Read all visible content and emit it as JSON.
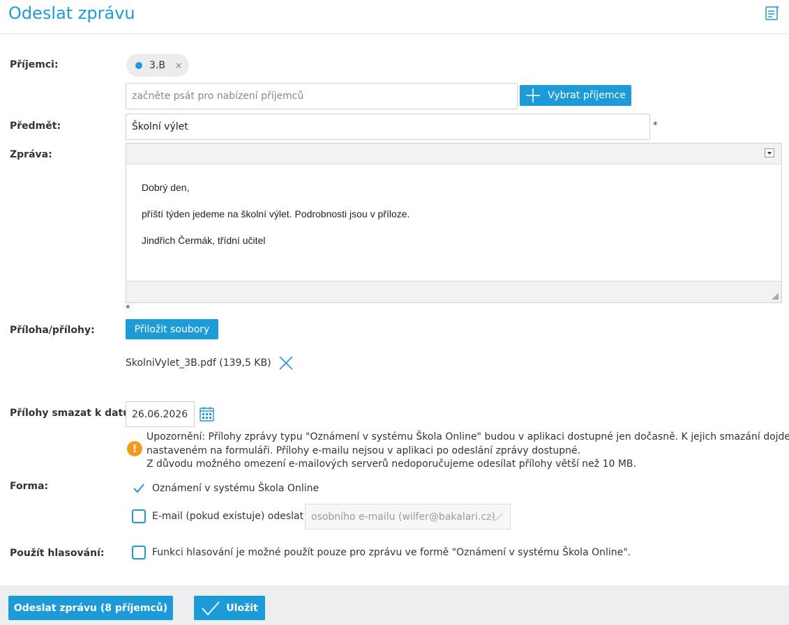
{
  "header": {
    "title": "Odeslat zprávu",
    "help_icon": "help-notes-icon"
  },
  "recipients": {
    "label": "Příjemci:",
    "chips": [
      {
        "text": "3.B",
        "remove": "×"
      }
    ],
    "input_placeholder": "začněte psát pro nabízení příjemců",
    "select_button": "Vybrat příjemce"
  },
  "subject": {
    "label": "Předmět:",
    "value": "Školní výlet",
    "required_mark": "*"
  },
  "message": {
    "label": "Zpráva:",
    "lines": [
      "Dobrý den,",
      "příští týden jedeme na školní výlet. Podrobnosti jsou v příloze.",
      "Jindřich Čermák, třídní učitel"
    ],
    "required_mark": "*"
  },
  "attachments": {
    "label": "Příloha/přílohy:",
    "attach_button": "Přiložit soubory",
    "files": [
      {
        "name": "SkolniVylet_3B.pdf (139,5 KB)"
      }
    ]
  },
  "delete_date": {
    "label": "Přílohy smazat k datu:",
    "value": "26.06.2026",
    "warning_lines": [
      "Upozornění: Přílohy zprávy typu \"Oznámení v systému Škola Online\" budou v aplikaci dostupné jen dočasně. K jejich smazání dojde k datu",
      "nastaveném na formuláři. Přílohy e-mailu nejsou v aplikaci po odeslání zprávy dostupné.",
      "Z důvodu možného omezení e-mailových serverů nedoporučujeme odesílat přílohy větší než 10 MB."
    ],
    "warning_icon": "!"
  },
  "form": {
    "label": "Forma:",
    "option_notice": {
      "label": "Oznámení v systému Škola Online",
      "checked": true
    },
    "option_email": {
      "label": "E-mail (pokud existuje) odeslat z:",
      "checked": false
    },
    "email_source": "osobního e-mailu (wilfer@bakalari.cz)"
  },
  "voting": {
    "label": "Použít hlasování:",
    "text": "Funkci hlasování je možné použít pouze pro zprávu ve formě \"Oznámení v systému Škola Online\".",
    "checked": false
  },
  "footer": {
    "send_button": "Odeslat zprávu (8 příjemců)",
    "save_button": "Uložit"
  },
  "colors": {
    "accent": "#1d9bd6",
    "warning": "#f39a1e",
    "footer_bg": "#eceeef"
  }
}
